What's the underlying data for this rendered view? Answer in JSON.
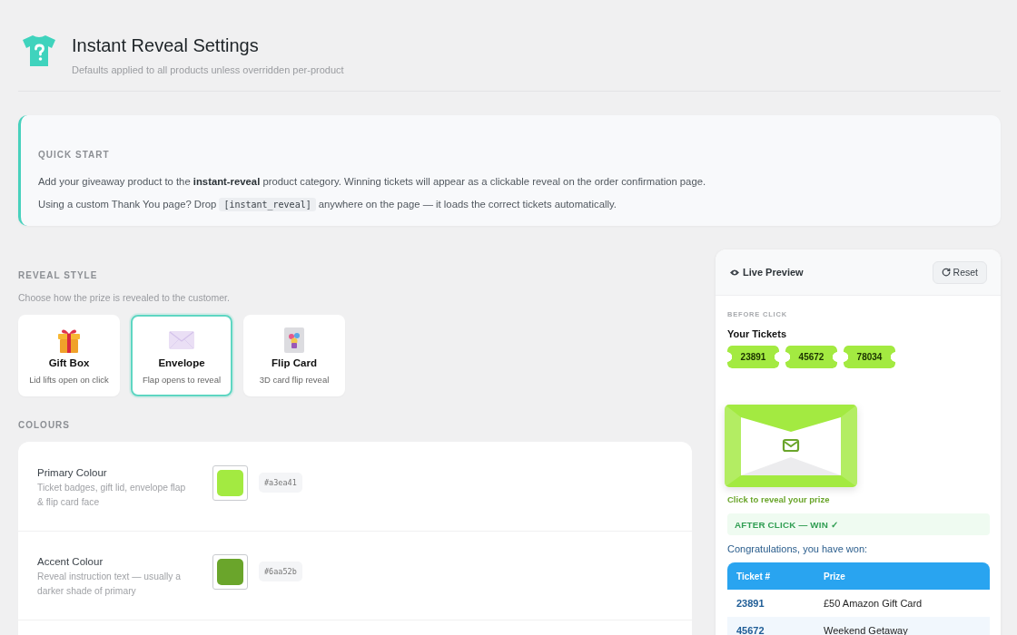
{
  "header": {
    "title": "Instant Reveal Settings",
    "subtitle": "Defaults applied to all products unless overridden per-product"
  },
  "quick_start": {
    "heading": "QUICK START",
    "intro": "Add your giveaway product to the **instant-reveal** product category. Winning tickets will appear as a clickable reveal on the order confirmation page.",
    "shortcode_tip": {
      "before": "Using a custom Thank You page? Drop",
      "code": "[instant_reveal]",
      "after": "anywhere on the page — it loads the correct tickets automatically."
    }
  },
  "reveal_style": {
    "heading": "REVEAL STYLE",
    "description": "Choose how the prize is revealed to the customer.",
    "options": [
      {
        "kind": "gift",
        "title": "Gift Box",
        "caption": "Lid lifts open on click",
        "selected": false
      },
      {
        "kind": "envelope",
        "title": "Envelope",
        "caption": "Flap opens to reveal",
        "selected": true
      },
      {
        "kind": "card",
        "title": "Flip Card",
        "caption": "3D card flip reveal",
        "selected": false
      }
    ]
  },
  "colours": {
    "heading": "COLOURS",
    "items": [
      {
        "label": "Primary Colour",
        "description": "Ticket badges, gift lid, envelope flap & flip card face",
        "color": "#a3ea41",
        "hex": "#a3ea41"
      },
      {
        "label": "Accent Colour",
        "description": "Reveal instruction text — usually a darker shade of primary",
        "color": "#6aa52b",
        "hex": "#6aa52b"
      }
    ]
  },
  "preview": {
    "title": "Live Preview",
    "reset": "Reset",
    "before_label": "BEFORE CLICK",
    "tickets_heading": "Your Tickets",
    "tickets": [
      "23891",
      "45672",
      "78034"
    ],
    "reveal_hint": "Click to reveal your prize",
    "after_label": "AFTER CLICK — WIN ✓",
    "congrats": "Congratulations, you have won:",
    "table": {
      "columns": [
        "Ticket #",
        "Prize"
      ],
      "rows": [
        [
          "23891",
          "£50 Amazon Gift Card"
        ],
        [
          "45672",
          "Weekend Getaway"
        ]
      ]
    }
  }
}
